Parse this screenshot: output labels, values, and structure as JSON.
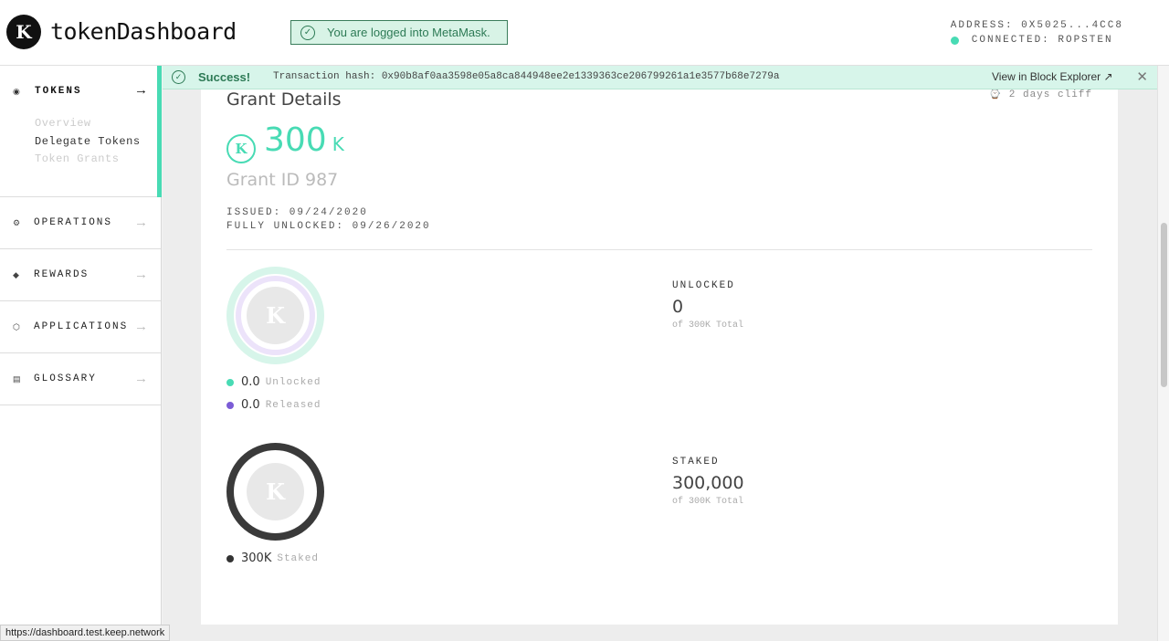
{
  "header": {
    "logo_letter": "K",
    "brand": "tokenDashboard",
    "metamask_toast": "You are logged into MetaMask.",
    "address": "ADDRESS: 0X5025...4CC8",
    "connected": "CONNECTED: ROPSTEN",
    "connected_color": "#48dbb4"
  },
  "sidebar": {
    "tokens_label": "TOKENS",
    "sub_items": [
      "Overview",
      "Delegate Tokens",
      "Token Grants"
    ],
    "items": [
      {
        "label": "OPERATIONS",
        "icon": "operations-icon"
      },
      {
        "label": "REWARDS",
        "icon": "rewards-icon"
      },
      {
        "label": "APPLICATIONS",
        "icon": "applications-icon"
      },
      {
        "label": "GLOSSARY",
        "icon": "glossary-icon"
      }
    ]
  },
  "banner": {
    "title": "Success!",
    "hash": "Transaction hash: 0x90b8af0aa3598e05a8ca844948ee2e1339363ce206799261a1e3577b68e7279a",
    "explorer": "View in Block Explorer"
  },
  "card": {
    "title": "Grant Details",
    "cliff": "2 days cliff",
    "amount": "300",
    "amount_unit": "K",
    "grant_id": "Grant ID 987",
    "issued": "ISSUED: 09/24/2020",
    "fully_unlocked": "FULLY UNLOCKED: 09/26/2020",
    "legend1": [
      {
        "value": "0.0",
        "label": "Unlocked",
        "color": "#48dbb4"
      },
      {
        "value": "0.0",
        "label": "Released",
        "color": "#7b5cd6"
      }
    ],
    "legend2": [
      {
        "value": "300K",
        "label": "Staked",
        "color": "#333333"
      }
    ],
    "unlocked": {
      "heading": "UNLOCKED",
      "value": "0",
      "sub": "of 300K Total"
    },
    "staked": {
      "heading": "STAKED",
      "value": "300,000",
      "sub": "of 300K Total"
    }
  },
  "status_url": "https://dashboard.test.keep.network"
}
